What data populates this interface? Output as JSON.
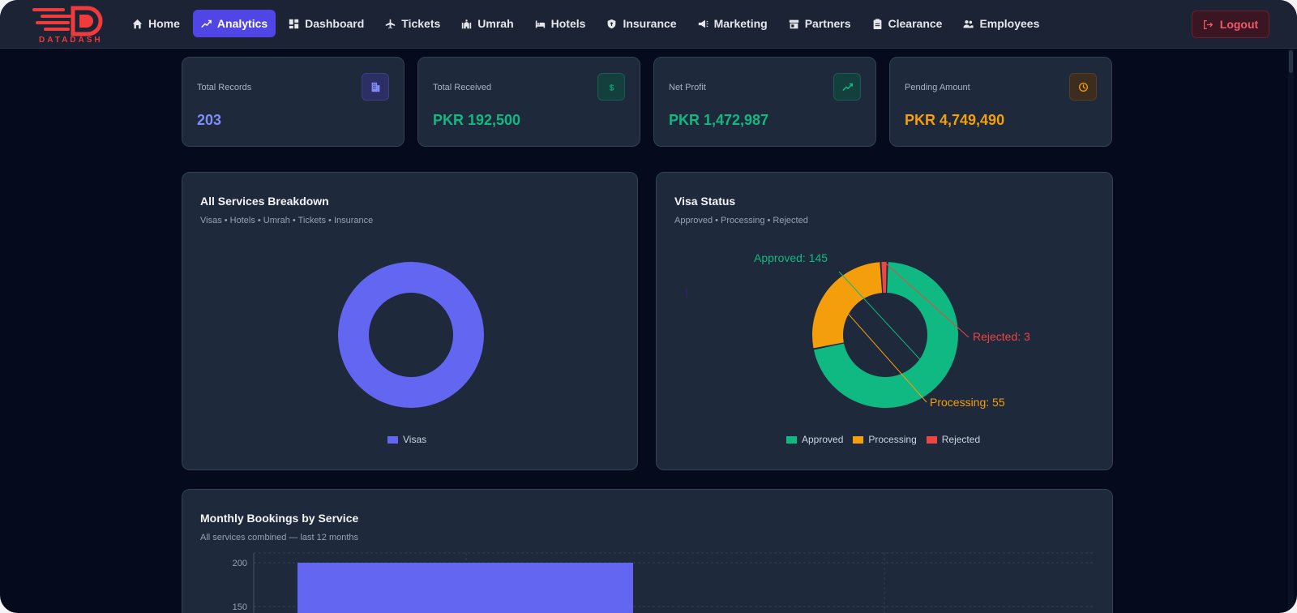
{
  "brand": {
    "name": "DATADASH",
    "color": "#ef3b3b"
  },
  "nav": {
    "items": [
      {
        "label": "Home",
        "icon": "home-icon",
        "active": false
      },
      {
        "label": "Analytics",
        "icon": "trending-up-icon",
        "active": true
      },
      {
        "label": "Dashboard",
        "icon": "dashboard-grid-icon",
        "active": false
      },
      {
        "label": "Tickets",
        "icon": "plane-icon",
        "active": false
      },
      {
        "label": "Umrah",
        "icon": "mosque-icon",
        "active": false
      },
      {
        "label": "Hotels",
        "icon": "bed-icon",
        "active": false
      },
      {
        "label": "Insurance",
        "icon": "shield-icon",
        "active": false
      },
      {
        "label": "Marketing",
        "icon": "megaphone-icon",
        "active": false
      },
      {
        "label": "Partners",
        "icon": "store-icon",
        "active": false
      },
      {
        "label": "Clearance",
        "icon": "clipboard-icon",
        "active": false
      },
      {
        "label": "Employees",
        "icon": "users-icon",
        "active": false
      }
    ],
    "logout_label": "Logout",
    "logout_icon": "logout-icon",
    "accent": "#4f46e5"
  },
  "stats": [
    {
      "label": "Total Records",
      "value": "203",
      "color": "#818cf8",
      "icon": "building-icon"
    },
    {
      "label": "Total Received",
      "value": "PKR 192,500",
      "color": "#10b981",
      "icon": "dollar-icon"
    },
    {
      "label": "Net Profit",
      "value": "PKR 1,472,987",
      "color": "#10b981",
      "icon": "trending-up-icon"
    },
    {
      "label": "Pending Amount",
      "value": "PKR 4,749,490",
      "color": "#f59e0b",
      "icon": "clock-icon"
    }
  ],
  "services_card": {
    "title": "All Services Breakdown",
    "subtitle": "Visas • Hotels • Umrah • Tickets • Insurance"
  },
  "visa_card": {
    "title": "Visa Status",
    "subtitle": "Approved • Processing • Rejected"
  },
  "monthly_card": {
    "title": "Monthly Bookings by Service",
    "subtitle": "All services combined — last 12 months"
  },
  "chart_data": [
    {
      "type": "pie",
      "title": "All Services Breakdown",
      "series": [
        {
          "name": "Visas",
          "value": 203,
          "color": "#6366f1"
        }
      ],
      "legend": "bottom"
    },
    {
      "type": "pie",
      "title": "Visa Status",
      "series": [
        {
          "name": "Approved",
          "value": 145,
          "label": "Approved: 145",
          "color": "#10b981"
        },
        {
          "name": "Processing",
          "value": 55,
          "label": "Processing: 55",
          "color": "#f59e0b"
        },
        {
          "name": "Rejected",
          "value": 3,
          "label": "Rejected: 3",
          "color": "#ef4444"
        }
      ],
      "legend": "bottom"
    },
    {
      "type": "bar",
      "title": "Monthly Bookings by Service",
      "yticks": [
        "200",
        "150"
      ],
      "ylim": [
        0,
        200
      ],
      "values": [
        200
      ],
      "color": "#6366f1",
      "grid": true
    }
  ]
}
